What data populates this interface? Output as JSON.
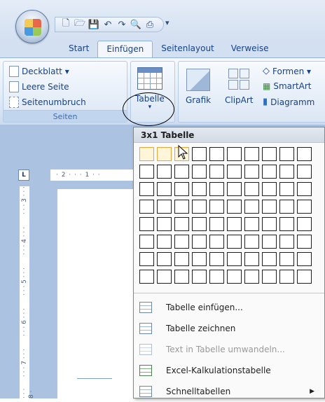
{
  "qat": {
    "icons": [
      "new-document-icon",
      "open-icon",
      "save-icon",
      "undo-icon",
      "redo-icon",
      "print-preview-icon",
      "print-icon"
    ],
    "more": "▾"
  },
  "tabs": [
    {
      "label": "Start",
      "active": false
    },
    {
      "label": "Einfügen",
      "active": true
    },
    {
      "label": "Seitenlayout",
      "active": false
    },
    {
      "label": "Verweise",
      "active": false
    }
  ],
  "ribbon": {
    "seiten": {
      "deckblatt": "Deckblatt ▾",
      "leere_seite": "Leere Seite",
      "seitenumbruch": "Seitenumbruch",
      "label": "Seiten"
    },
    "tabelle": {
      "label": "Tabelle",
      "arrow": "▾"
    },
    "illustrationen": {
      "grafik": "Grafik",
      "clipart": "ClipArt",
      "formen": "Formen ▾",
      "smartart": "SmartArt",
      "diagramm": "Diagramm"
    }
  },
  "ruler": {
    "corner": "L",
    "h_text": "· 2 · · · 1 · ·",
    "v_marks": [
      "· · · 3 · · ·",
      "· · · 4 · · ·",
      "· · · 5 · · ·",
      "· · · 6 · · ·",
      "· · · 7 · · ·",
      "· · · 8 ·"
    ]
  },
  "dropdown": {
    "header": "3x1 Tabelle",
    "grid": {
      "cols": 10,
      "rows": 8,
      "selected_cols": 3,
      "selected_rows": 1
    },
    "items": [
      {
        "label": "Tabelle einfügen...",
        "icon": "insert-table-icon",
        "enabled": true,
        "submenu": false
      },
      {
        "label": "Tabelle zeichnen",
        "icon": "draw-table-icon",
        "enabled": true,
        "submenu": false
      },
      {
        "label": "Text in Tabelle umwandeln...",
        "icon": "convert-text-icon",
        "enabled": false,
        "submenu": false
      },
      {
        "label": "Excel-Kalkulationstabelle",
        "icon": "excel-sheet-icon",
        "enabled": true,
        "submenu": false
      },
      {
        "label": "Schnelltabellen",
        "icon": "quick-tables-icon",
        "enabled": true,
        "submenu": true
      }
    ],
    "submenu_arrow": "▶"
  }
}
